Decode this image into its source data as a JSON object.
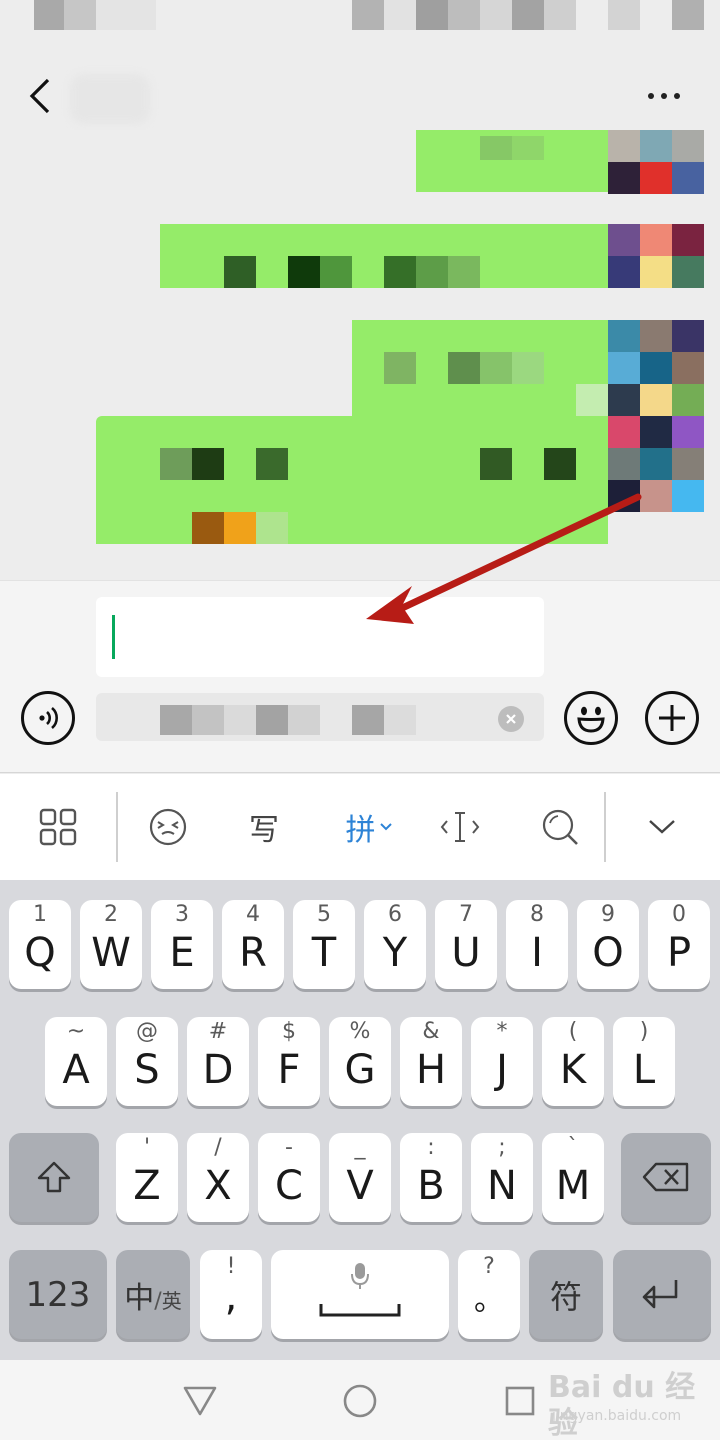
{
  "header": {
    "back_icon": "chevron-left-icon",
    "more_icon": "more-dots-icon"
  },
  "input": {
    "value": "",
    "voice_icon": "voice-icon",
    "emoji_icon": "emoji-icon",
    "plus_icon": "plus-icon",
    "clear_icon": "clear-icon"
  },
  "toolbar": {
    "grid_icon": "grid-icon",
    "emoticon_icon": "emoticon-icon",
    "handwriting_label": "写",
    "pinyin_label": "拼",
    "cursor_icon": "cursor-move-icon",
    "search_icon": "search-icon",
    "collapse_icon": "chevron-down-icon",
    "accent_color": "#2d83d6"
  },
  "keyboard": {
    "row1": [
      {
        "main": "Q",
        "sub": "1"
      },
      {
        "main": "W",
        "sub": "2"
      },
      {
        "main": "E",
        "sub": "3"
      },
      {
        "main": "R",
        "sub": "4"
      },
      {
        "main": "T",
        "sub": "5"
      },
      {
        "main": "Y",
        "sub": "6"
      },
      {
        "main": "U",
        "sub": "7"
      },
      {
        "main": "I",
        "sub": "8"
      },
      {
        "main": "O",
        "sub": "9"
      },
      {
        "main": "P",
        "sub": "0"
      }
    ],
    "row2": [
      {
        "main": "A",
        "sub": "~"
      },
      {
        "main": "S",
        "sub": "@"
      },
      {
        "main": "D",
        "sub": "#"
      },
      {
        "main": "F",
        "sub": "$"
      },
      {
        "main": "G",
        "sub": "%"
      },
      {
        "main": "H",
        "sub": "&"
      },
      {
        "main": "J",
        "sub": "*"
      },
      {
        "main": "K",
        "sub": "("
      },
      {
        "main": "L",
        "sub": ")"
      }
    ],
    "row3": [
      {
        "main": "Z",
        "sub": "'"
      },
      {
        "main": "X",
        "sub": "/"
      },
      {
        "main": "C",
        "sub": "-"
      },
      {
        "main": "V",
        "sub": "_"
      },
      {
        "main": "B",
        "sub": ":"
      },
      {
        "main": "N",
        "sub": ";"
      },
      {
        "main": "M",
        "sub": "`"
      }
    ],
    "shift_icon": "shift-icon",
    "backspace_icon": "backspace-icon",
    "num_label": "123",
    "lang_main": "中",
    "lang_sep": "/",
    "lang_sub": "英",
    "comma_main": ",",
    "comma_sub": "!",
    "period_main": "。",
    "period_sub": "?",
    "symbol_label": "符",
    "mic_icon": "mic-icon",
    "enter_icon": "enter-icon"
  },
  "navbar": {
    "back_icon": "triangle-back-icon",
    "home_icon": "circle-home-icon",
    "recent_icon": "square-recent-icon",
    "watermark_main": "Bai du 经验",
    "watermark_sub": "jingyan.baidu.com"
  }
}
